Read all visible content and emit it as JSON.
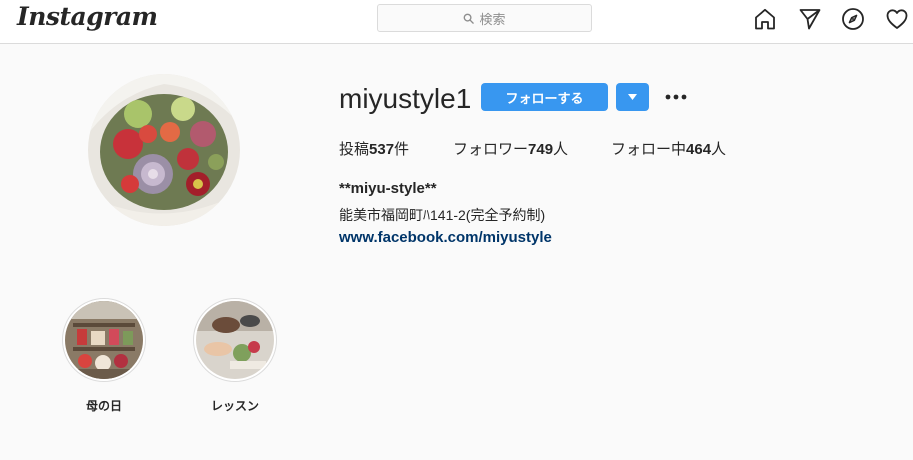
{
  "nav": {
    "logo": "Instagram",
    "search_placeholder": "検索",
    "icons": [
      "home-icon",
      "direct-icon",
      "explore-icon",
      "activity-heart-icon"
    ]
  },
  "profile": {
    "username": "miyustyle1",
    "follow_label": "フォローする",
    "stats": {
      "posts_label": "投稿",
      "posts_count": "537",
      "posts_unit": "件",
      "followers_label": "フォロワー",
      "followers_count": "749",
      "followers_unit": "人",
      "following_label": "フォロー中",
      "following_count": "464",
      "following_unit": "人"
    },
    "bio_name": "**miyu-style**",
    "bio_text": "能美市福岡町ﾊ141-2(完全予約制)",
    "bio_link": "www.facebook.com/miyustyle"
  },
  "highlights": [
    {
      "label": "母の日"
    },
    {
      "label": "レッスン"
    }
  ],
  "colors": {
    "accent": "#3897f0",
    "link": "#003569",
    "background": "#fafafa",
    "border": "#dbdbdb"
  }
}
